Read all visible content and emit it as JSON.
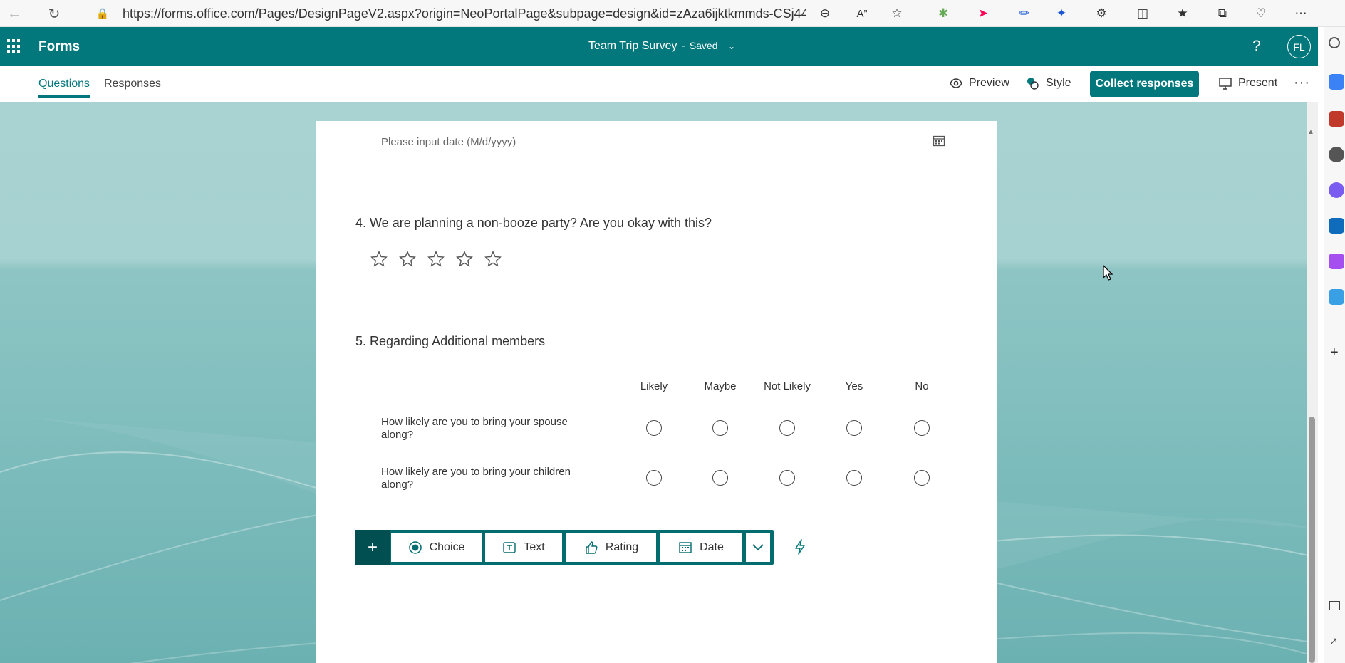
{
  "browser": {
    "url": "https://forms.office.com/Pages/DesignPageV2.aspx?origin=NeoPortalPage&subpage=design&id=zAza6ijktkmmds-CSj44U...",
    "icons": [
      "back-icon",
      "refresh-icon",
      "lock-icon",
      "zoom-out-icon",
      "read-aloud-icon",
      "favorite-star-icon",
      "extensions-icon",
      "split-screen-icon",
      "favorites-icon",
      "collections-icon",
      "browser-essentials-icon",
      "settings-more-icon"
    ]
  },
  "header": {
    "app_name": "Forms",
    "doc_title": "Team Trip Survey",
    "separator": "-",
    "status": "Saved",
    "avatar_initials": "FL",
    "brand_color": "#03787c"
  },
  "commandbar": {
    "tabs": [
      {
        "label": "Questions",
        "active": true
      },
      {
        "label": "Responses",
        "active": false
      }
    ],
    "preview_label": "Preview",
    "style_label": "Style",
    "collect_label": "Collect responses",
    "present_label": "Present",
    "more_label": "···"
  },
  "form": {
    "date_placeholder": "Please input date (M/d/yyyy)",
    "q4": {
      "title": "4. We are planning a non-booze party? Are you okay with this?",
      "stars": 5
    },
    "q5": {
      "title": "5. Regarding Additional members",
      "columns": [
        "Likely",
        "Maybe",
        "Not Likely",
        "Yes",
        "No"
      ],
      "rows": [
        "How likely are you to bring your spouse along?",
        "How likely are you to bring your children along?"
      ]
    }
  },
  "add_toolbar": {
    "plus": "+",
    "types": [
      {
        "label": "Choice",
        "icon": "radio-choice-icon"
      },
      {
        "label": "Text",
        "icon": "text-icon"
      },
      {
        "label": "Rating",
        "icon": "thumbs-up-icon"
      },
      {
        "label": "Date",
        "icon": "calendar-icon"
      }
    ]
  }
}
